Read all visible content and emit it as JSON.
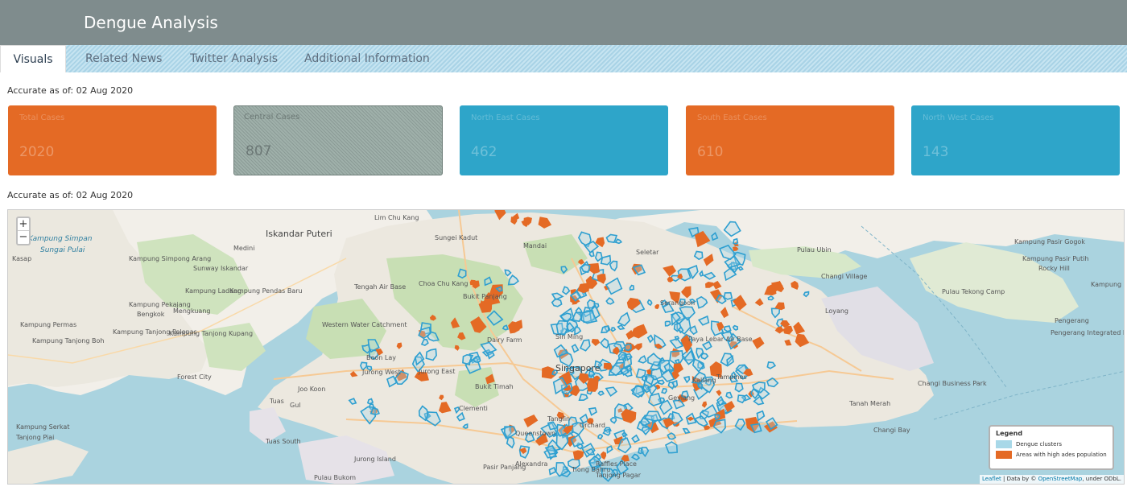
{
  "header": {
    "title": "Dengue Analysis"
  },
  "tabs": [
    {
      "label": "Visuals"
    },
    {
      "label": "Related News"
    },
    {
      "label": "Twitter Analysis"
    },
    {
      "label": "Additional Information"
    }
  ],
  "as_of_top": "Accurate as of: 02 Aug 2020",
  "as_of_map": "Accurate as of: 02 Aug 2020",
  "cards": [
    {
      "label": "Total Cases",
      "value": "2020",
      "color": "#e46a25"
    },
    {
      "label": "Central Cases",
      "value": "807",
      "color": "#95a5a0"
    },
    {
      "label": "North East Cases",
      "value": "462",
      "color": "#2ea5c9"
    },
    {
      "label": "South East Cases",
      "value": "610",
      "color": "#e46a25"
    },
    {
      "label": "North West Cases",
      "value": "143",
      "color": "#2ea5c9"
    }
  ],
  "map": {
    "zoom_in": "+",
    "zoom_out": "−",
    "legend": {
      "title": "Legend",
      "items": [
        {
          "label": "Dengue clusters",
          "color": "#a8d8e8"
        },
        {
          "label": "Areas with high ades population",
          "color": "#e46a25"
        }
      ]
    },
    "attribution": {
      "leaflet": "Leaflet",
      "sep": " | Data by © ",
      "osm": "OpenStreetMap",
      "tail": ", under ODbL."
    },
    "place_labels": [
      "Lim Chu Kang",
      "Iskandar Puteri",
      "Sungei Kadut",
      "Mandai",
      "Seletar",
      "Pulau Ubin",
      "Kampung Pasir Gogok",
      "Rocky Hill",
      "Kampung Pasir Putih",
      "Pulau Tekong Camp",
      "Kampung Lepau",
      "Pengerang",
      "Pengerang Integrated Petrochemical Complex (PIPC)",
      "Changi Village",
      "Loyang",
      "Changi Business Park",
      "Tanah Merah",
      "Changi Bay",
      "Medini",
      "Sunway Iskandar",
      "Kampung Simpong Arang",
      "Kampung Ladang",
      "Kampung Pendas Baru",
      "Kampung Pekajang",
      "Bengkok",
      "Mengkuang",
      "Kampung Tanjong Pelepas",
      "Kampung Tanjong Kupang",
      "Kampung Permas",
      "Kampung Tanjong Boh",
      "Forest City",
      "Kampung Serkat",
      "Tanjong Piai",
      "Tuas South",
      "Tuas",
      "Joo Koon",
      "Gul",
      "Jurong Island",
      "Pulau Bukom",
      "Western Water Catchment",
      "Tengah Air Base",
      "Choa Chu Kang",
      "Bukit Panjang",
      "Dairy Farm",
      "Boon Lay",
      "Jurong West",
      "Jurong East",
      "Bukit Timah",
      "Clementi",
      "Queenstown",
      "Tanglin",
      "Orchard",
      "Singapore",
      "Sin Ming",
      "Paya Lebar Air Base",
      "Tampines",
      "Serangoon",
      "Kallang",
      "Geylang",
      "Pasir Panjang",
      "Alexandra",
      "Tiong Bahru",
      "Raffles Place",
      "Tanjong Pagar",
      "Kampung Simpan",
      "Sungai Pulai",
      "Kasap"
    ]
  }
}
